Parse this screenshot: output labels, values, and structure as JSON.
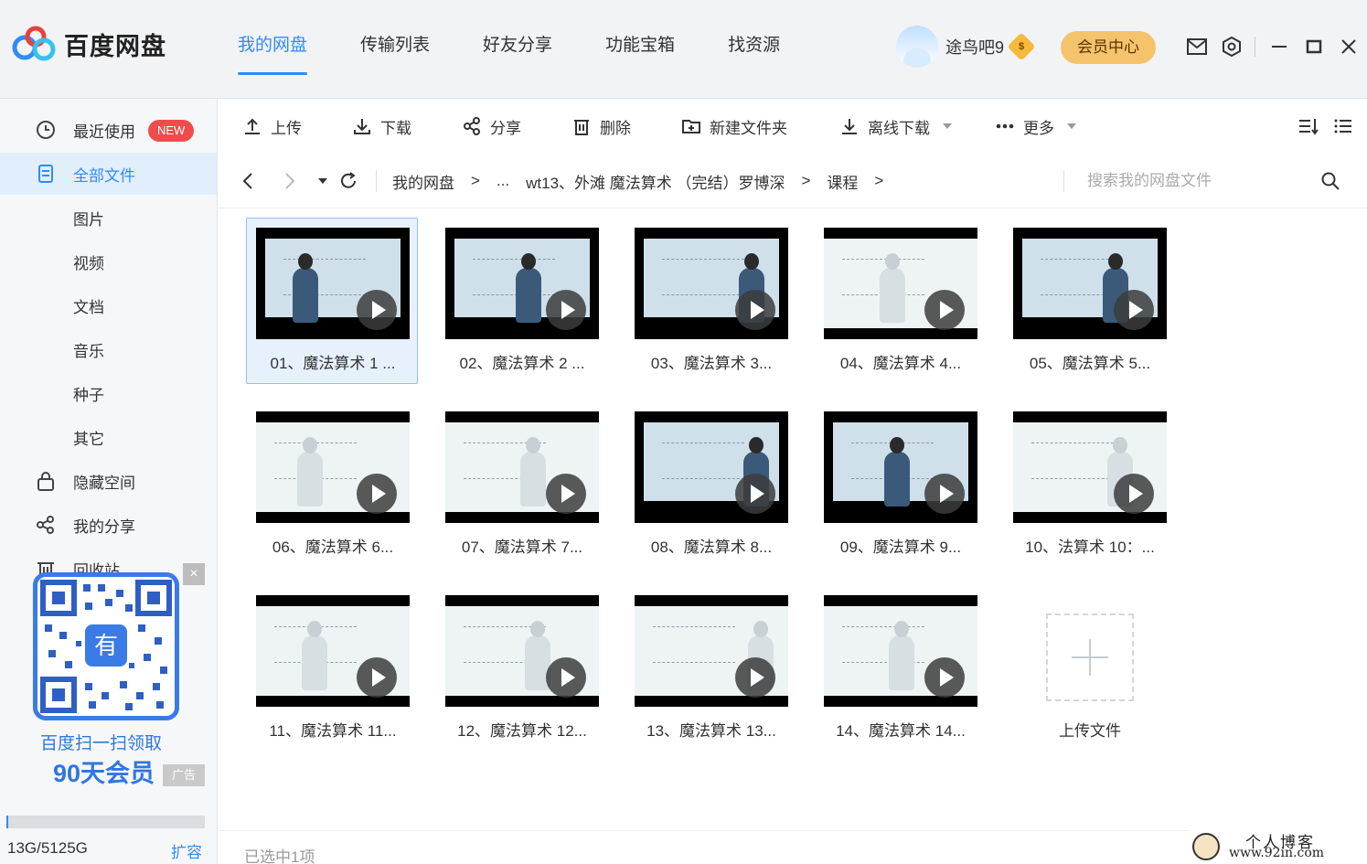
{
  "app": {
    "title": "百度网盘"
  },
  "nav": {
    "items": [
      "我的网盘",
      "传输列表",
      "好友分享",
      "功能宝箱",
      "找资源"
    ]
  },
  "user": {
    "name": "途鸟吧9",
    "vip_symbol": "$",
    "vip_center": "会员中心"
  },
  "sidebar": {
    "items": [
      {
        "label": "最近使用",
        "badge": "NEW"
      },
      {
        "label": "全部文件"
      },
      {
        "label": "图片"
      },
      {
        "label": "视频"
      },
      {
        "label": "文档"
      },
      {
        "label": "音乐"
      },
      {
        "label": "种子"
      },
      {
        "label": "其它"
      },
      {
        "label": "隐藏空间"
      },
      {
        "label": "我的分享"
      },
      {
        "label": "回收站"
      }
    ],
    "promo": {
      "line1": "百度扫一扫领取",
      "line2": "90天会员",
      "ad": "广告",
      "close": "×",
      "center_glyph": "有"
    },
    "storage": {
      "text": "13G/5125G",
      "used_fraction": 0.003,
      "expand": "扩容"
    }
  },
  "toolbar": {
    "upload": "上传",
    "download": "下载",
    "share": "分享",
    "delete": "删除",
    "new_folder": "新建文件夹",
    "offline": "离线下载",
    "more": "更多"
  },
  "breadcrumb": {
    "items": [
      "我的网盘",
      "...",
      "wt13、外滩 魔法算术 （完结）罗博深",
      "课程"
    ],
    "separator": ">"
  },
  "search": {
    "placeholder": "搜索我的网盘文件"
  },
  "files": [
    {
      "name": "01、魔法算术 1 ..."
    },
    {
      "name": "02、魔法算术 2 ..."
    },
    {
      "name": "03、魔法算术 3..."
    },
    {
      "name": "04、魔法算术 4..."
    },
    {
      "name": "05、魔法算术 5..."
    },
    {
      "name": "06、魔法算术 6..."
    },
    {
      "name": "07、魔法算术 7..."
    },
    {
      "name": "08、魔法算术 8..."
    },
    {
      "name": "09、魔法算术 9..."
    },
    {
      "name": "10、法算术 10：..."
    },
    {
      "name": "11、魔法算术 11..."
    },
    {
      "name": "12、魔法算术 12..."
    },
    {
      "name": "13、魔法算术 13..."
    },
    {
      "name": "14、魔法算术 14..."
    }
  ],
  "upload_tile": {
    "label": "上传文件"
  },
  "status": {
    "text": "已选中1项"
  },
  "watermark": {
    "line1": "个人博客",
    "line2": "www.92in.com"
  },
  "colors": {
    "accent": "#2f8cf8",
    "vip": "#f5c36b",
    "new_badge": "#f04c4c"
  }
}
